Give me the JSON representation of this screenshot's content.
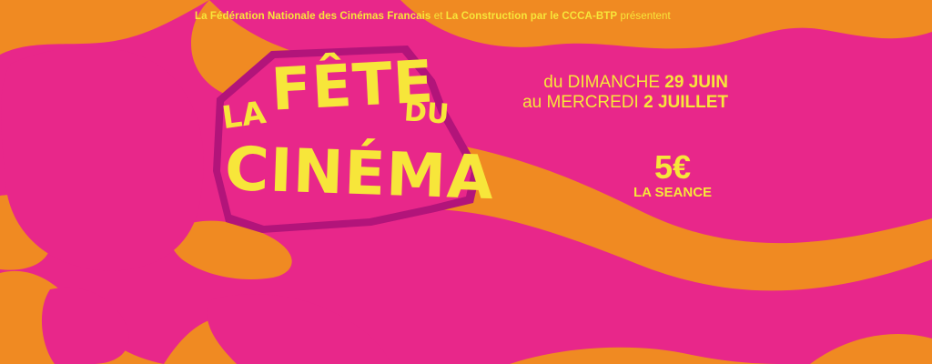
{
  "colors": {
    "background": "#e8278a",
    "orange": "#f08a22",
    "yellow": "#f7e63a",
    "logo_shadow": "#b2147a"
  },
  "header": {
    "presenter_1": "La Fédération Nationale des Cinémas Francais",
    "conjunction": "et",
    "presenter_2": "La Construction par le CCCA-BTP",
    "verb": "présentent"
  },
  "logo": {
    "la": "LA",
    "fete": "FÊTE",
    "du": "DU",
    "cinema": "CINÉMA"
  },
  "dates": {
    "start_prefix": "du DIMANCHE",
    "start_date": "29 JUIN",
    "end_prefix": "au MERCREDI",
    "end_date": "2 JUILLET"
  },
  "price": {
    "amount": "5€",
    "label": "LA SEANCE"
  }
}
